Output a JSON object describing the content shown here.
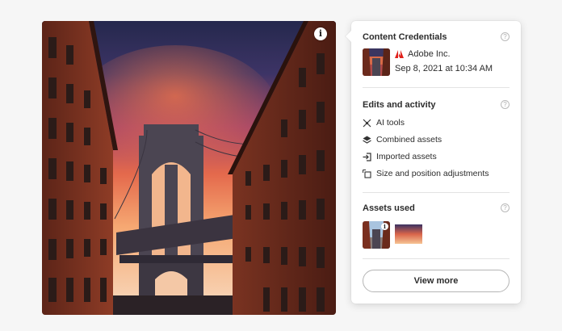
{
  "panel": {
    "content_credentials": {
      "title": "Content Credentials",
      "issuer": "Adobe Inc.",
      "date": "Sep 8, 2021 at 10:34 AM"
    },
    "edits": {
      "title": "Edits and activity",
      "items": [
        {
          "label": "AI tools",
          "icon": "ai-tools-icon"
        },
        {
          "label": "Combined assets",
          "icon": "layers-icon"
        },
        {
          "label": "Imported assets",
          "icon": "import-icon"
        },
        {
          "label": "Size and position adjustments",
          "icon": "transform-icon"
        }
      ]
    },
    "assets": {
      "title": "Assets used"
    },
    "view_more_label": "View more"
  },
  "photo": {
    "info_badge": "i"
  },
  "colors": {
    "accent_adobe": "#e0211b",
    "panel_bg": "#ffffff",
    "page_bg": "#f6f6f6"
  }
}
